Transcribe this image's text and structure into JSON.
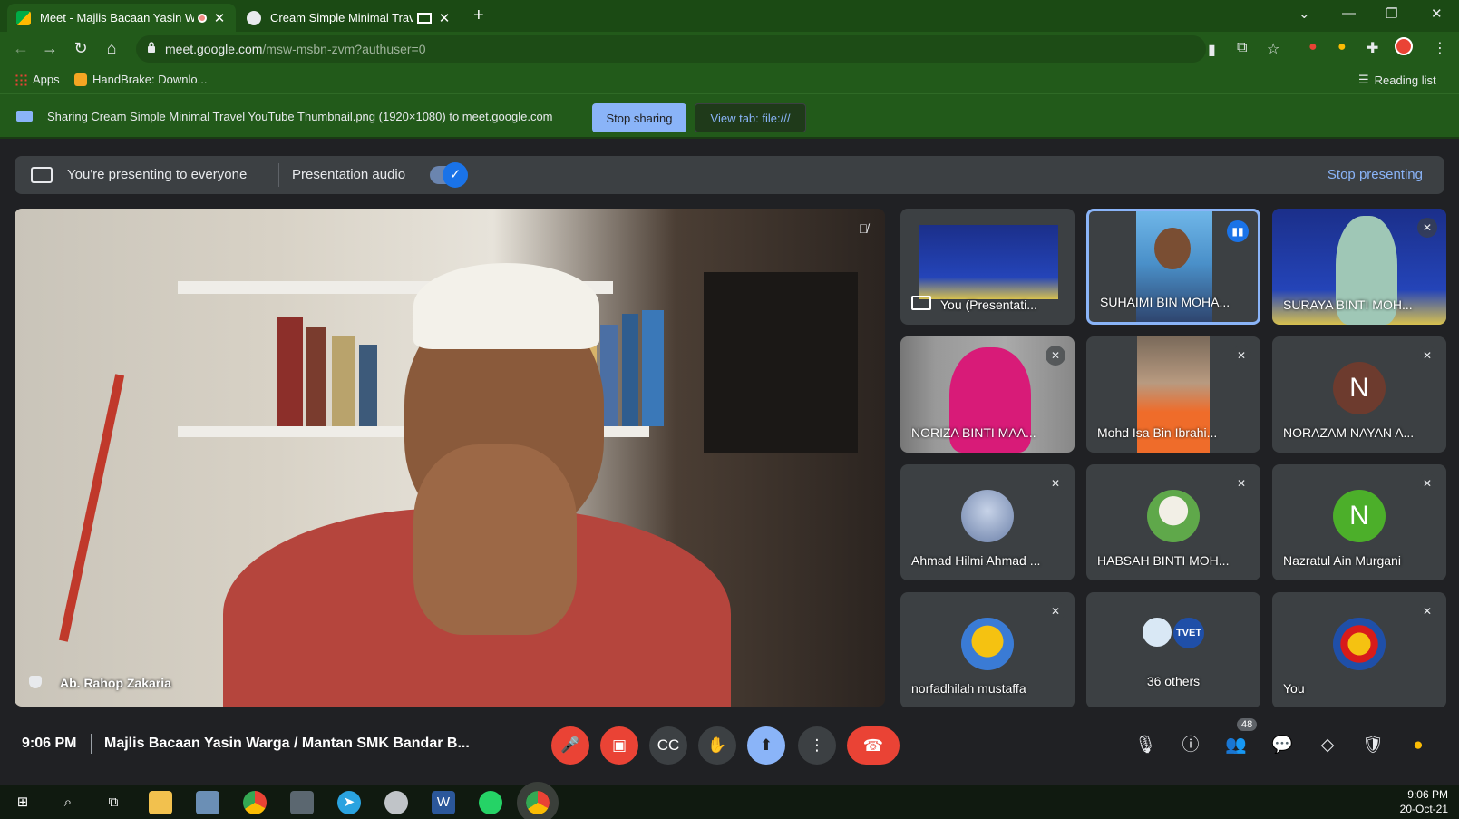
{
  "browser": {
    "tabs": [
      {
        "title": "Meet - Majlis Bacaan Yasin W",
        "active": true
      },
      {
        "title": "Cream Simple Minimal Trave",
        "active": false
      }
    ],
    "new_tab": "+",
    "url_domain": "meet.google.com",
    "url_path": "/msw-msbn-zvm?authuser=0",
    "bookmarks": [
      "Apps",
      "HandBrake: Downlo..."
    ],
    "reading_list": "Reading list"
  },
  "share_banner": {
    "text": "Sharing Cream Simple Minimal Travel YouTube Thumbnail.png (1920×1080) to meet.google.com",
    "stop_label": "Stop sharing",
    "view_label": "View tab: file:///"
  },
  "presenting_bar": {
    "text": "You're presenting to everyone",
    "audio_label": "Presentation audio",
    "audio_on": true,
    "stop_label": "Stop presenting"
  },
  "main_speaker": {
    "name": "Ab. Rahop Zakaria"
  },
  "tiles": [
    {
      "name": "You (Presentati...",
      "type": "presentation"
    },
    {
      "name": "SUHAIMI BIN MOHA...",
      "type": "video",
      "speaking": true
    },
    {
      "name": "SURAYA BINTI MOH...",
      "type": "video"
    },
    {
      "name": "NORIZA BINTI MAA...",
      "type": "video"
    },
    {
      "name": "Mohd Isa Bin Ibrahi...",
      "type": "video"
    },
    {
      "name": "NORAZAM NAYAN A...",
      "type": "avatar",
      "initial": "N",
      "color": "#6d3b2e"
    },
    {
      "name": "Ahmad Hilmi Ahmad ...",
      "type": "photo"
    },
    {
      "name": "HABSAH BINTI MOH...",
      "type": "photo"
    },
    {
      "name": "Nazratul Ain Murgani",
      "type": "avatar",
      "initial": "N",
      "color": "#4caf2a"
    },
    {
      "name": "norfadhilah mustaffa",
      "type": "photo"
    },
    {
      "name": "36 others",
      "type": "others"
    },
    {
      "name": "You",
      "type": "photo"
    }
  ],
  "meeting": {
    "time": "9:06 PM",
    "title": "Majlis Bacaan Yasin Warga / Mantan SMK Bandar B...",
    "participants_count": "48"
  },
  "taskbar": {
    "time": "9:06 PM",
    "date": "20-Oct-21"
  }
}
